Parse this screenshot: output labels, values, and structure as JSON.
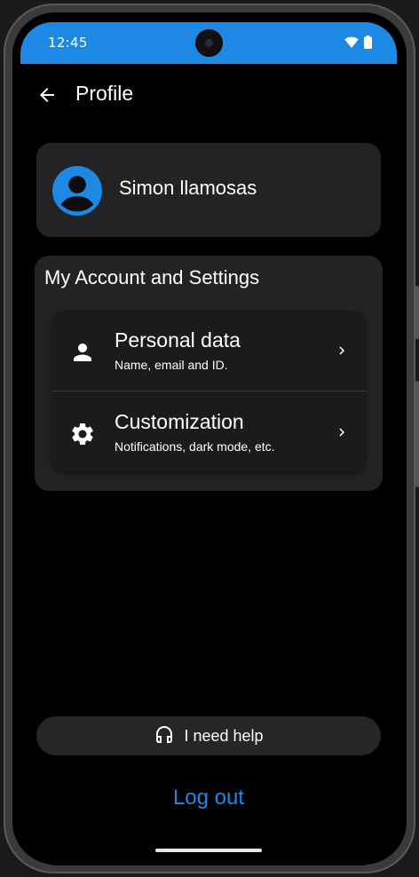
{
  "status_bar": {
    "time": "12:45",
    "background_color": "#1e88e5",
    "icons": [
      "wifi-icon",
      "battery-icon"
    ]
  },
  "app_bar": {
    "back_icon": "arrow-left-icon",
    "title": "Profile"
  },
  "user": {
    "avatar_icon": "account-circle-icon",
    "avatar_color": "#1e88e5",
    "name": "Simon llamosas"
  },
  "settings": {
    "section_title": "My Account and Settings",
    "items": [
      {
        "icon": "person-icon",
        "title": "Personal data",
        "subtitle": "Name, email and ID."
      },
      {
        "icon": "gear-icon",
        "title": "Customization",
        "subtitle": "Notifications, dark mode, etc."
      }
    ]
  },
  "help": {
    "icon": "headset-icon",
    "label": "I need help"
  },
  "logout": {
    "label": "Log out",
    "color": "#1e88e5"
  }
}
